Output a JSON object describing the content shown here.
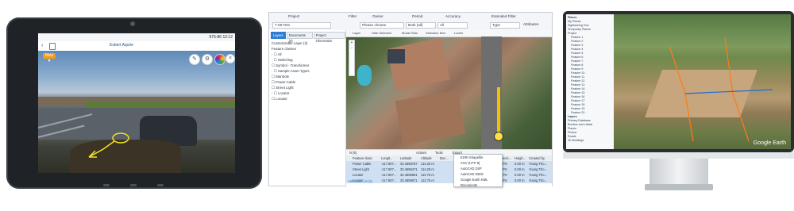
{
  "tablet": {
    "time": "975-86 12:12",
    "app_title": "Esbert Aquire",
    "tag_label": "New ▼",
    "icons": [
      "edit-icon",
      "settings-icon",
      "palette-icon",
      "close-icon"
    ]
  },
  "desktop": {
    "header": {
      "project_label": "Project",
      "project_value": "7-Mt Test",
      "filter_label": "Filter",
      "owner_label": "Owner",
      "owner_value": "Please choose",
      "period_label": "Period",
      "period_value": "Both (all)",
      "accuracy_label": "Accuracy",
      "accuracy_value": "All",
      "extended_filter_label": "Extended Filter",
      "type_value": "Type",
      "attributes_label": "Attributes"
    },
    "tabs": [
      "Layers",
      "Documents (0)",
      "Project information"
    ],
    "tree": [
      "Customizable Layer (3)",
      "Feature classes",
      "- ☐ All",
      "  - ☐ Switching",
      "     ☐ Symbol - Transformer",
      "  - ☐ Sample Asset Types",
      "     ☐ Manhole",
      "     ☐ Power Cable",
      "     ☐ Street Light",
      "  - ☐ Locator",
      "     ☐ Locator"
    ],
    "map_toolbar": [
      "Layer",
      "Hide Selected",
      "Model Sets",
      "Selection Item",
      "Lorem"
    ],
    "table": {
      "summary": "N (5)",
      "buttons": [
        "Actions",
        "Tools",
        "Export"
      ],
      "columns": [
        "Feature class",
        "Longit...",
        "Latitude",
        "Altitude",
        "Dec...",
        "Accu...",
        "Recei...",
        "Heigh...",
        "Created by"
      ],
      "rows": [
        [
          "Power Cable",
          "-117.907...",
          "33.4659757",
          "114.25 m",
          "",
          "0.05 ...",
          "GPS",
          "0.00 m",
          "Young Tho..."
        ],
        [
          "Street Light",
          "-117.907...",
          "33.4659471",
          "114.28 m",
          "",
          "0.05 ...",
          "GPS",
          "0.00 m",
          "Young Tho..."
        ],
        [
          "Locator",
          "-117.907...",
          "33.4659551",
          "112.76 m",
          "",
          "0.05 ...",
          "GPS",
          "0.00 m",
          "Young Tho..."
        ],
        [
          "Locator",
          "-117.907...",
          "33.4659571",
          "112.75 m",
          "",
          "0.05 ...",
          "GPS",
          "0.00 m",
          "Young Tho..."
        ]
      ],
      "footer": "Attributes List (5)"
    },
    "export_menu": [
      "ESRI Shapefile",
      "CSV (UTF-8)",
      "AutoCAD DXF",
      "AutoCAD DWG",
      "Google Earth KML",
      "Documents"
    ]
  },
  "monitor": {
    "sidebar_items": [
      "Places",
      "My Places",
      "Sightseeing Tour",
      "Temporary Places",
      "Project",
      "Feature 1",
      "Feature 2",
      "Feature 3",
      "Feature 4",
      "Feature 5",
      "Feature 6",
      "Feature 7",
      "Feature 8",
      "Feature 9",
      "Feature 10",
      "Feature 11",
      "Feature 12",
      "Feature 13",
      "Feature 14",
      "Feature 15",
      "Feature 16",
      "Feature 17",
      "Feature 18",
      "Feature 19",
      "Feature 20",
      "Layers",
      "Primary Database",
      "Borders and Labels",
      "Places",
      "Photos",
      "Roads",
      "3D Buildings"
    ],
    "watermark": "Google Earth"
  }
}
